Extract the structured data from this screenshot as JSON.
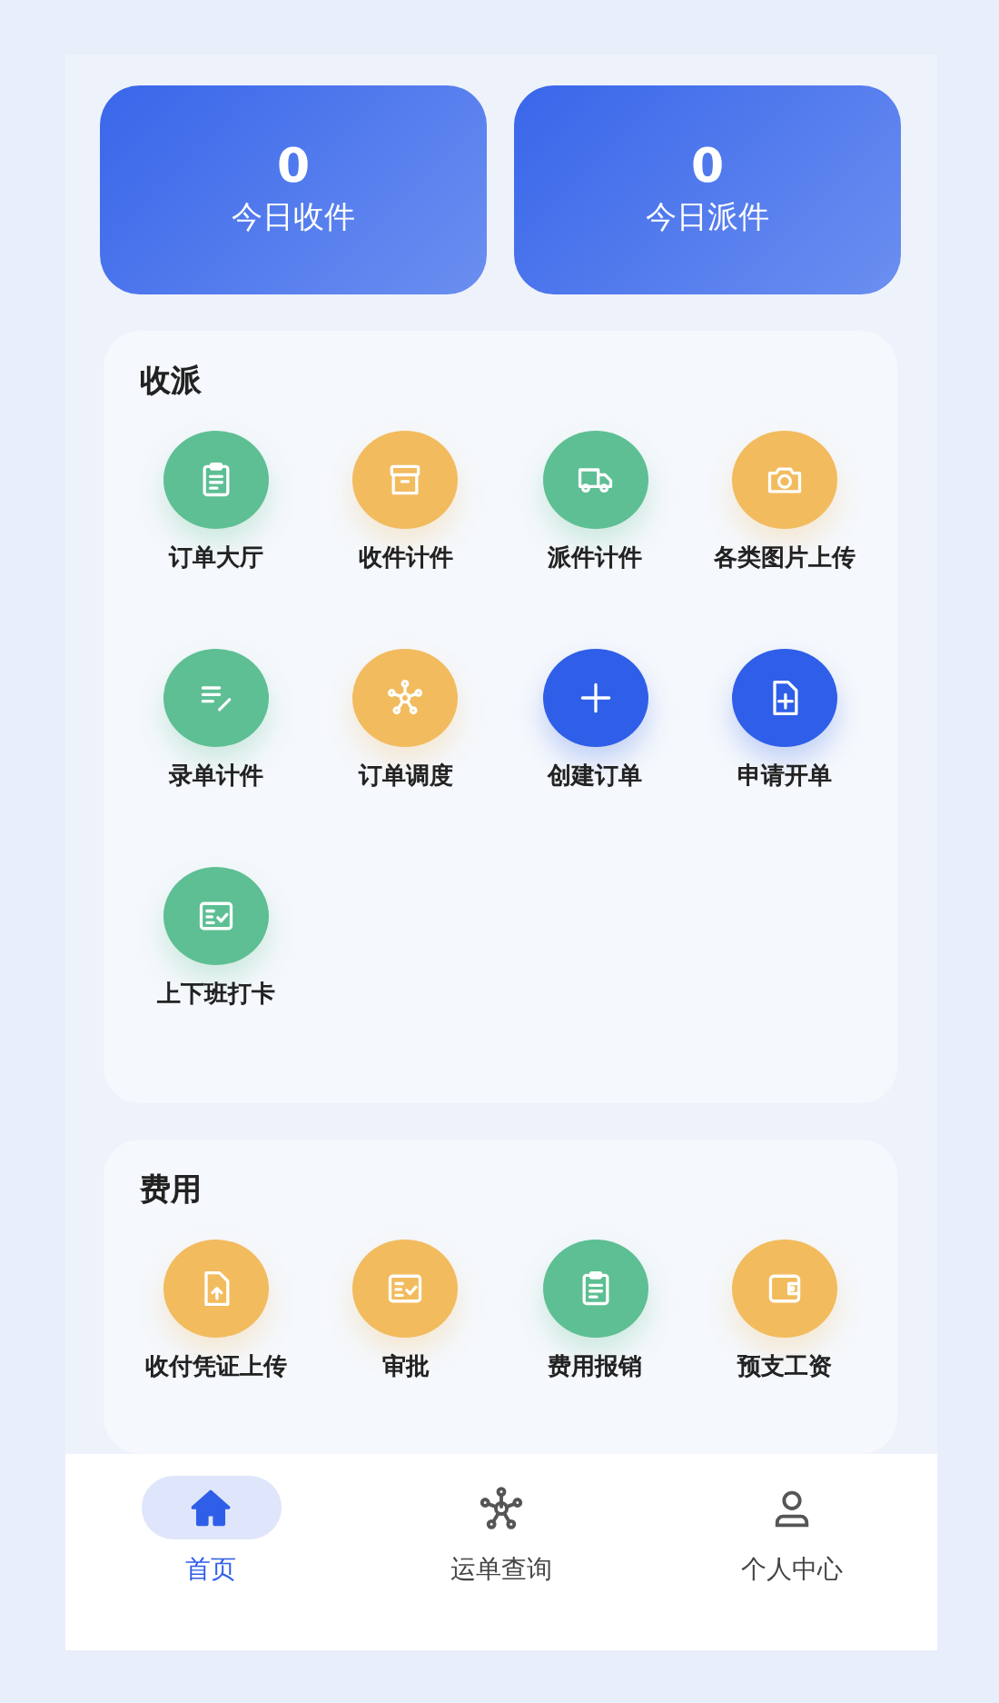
{
  "stats": [
    {
      "value": "0",
      "label": "今日收件"
    },
    {
      "value": "0",
      "label": "今日派件"
    }
  ],
  "sections": [
    {
      "title": "收派",
      "items": [
        {
          "label": "订单大厅",
          "color": "#5dbf93"
        },
        {
          "label": "收件计件",
          "color": "#f2bb5e"
        },
        {
          "label": "派件计件",
          "color": "#5dbf93"
        },
        {
          "label": "各类图片上传",
          "color": "#f2bb5e"
        },
        {
          "label": "录单计件",
          "color": "#5dbf93"
        },
        {
          "label": "订单调度",
          "color": "#f2bb5e"
        },
        {
          "label": "创建订单",
          "color": "#2f5ee8"
        },
        {
          "label": "申请开单",
          "color": "#2f5ee8"
        },
        {
          "label": "上下班打卡",
          "color": "#5dbf93"
        }
      ]
    },
    {
      "title": "费用",
      "items": [
        {
          "label": "收付凭证上传",
          "color": "#f2bb5e"
        },
        {
          "label": "审批",
          "color": "#f2bb5e"
        },
        {
          "label": "费用报销",
          "color": "#5dbf93"
        },
        {
          "label": "预支工资",
          "color": "#f2bb5e"
        }
      ]
    }
  ],
  "nav": [
    {
      "label": "首页",
      "selected": true
    },
    {
      "label": "运单查询",
      "selected": false
    },
    {
      "label": "个人中心",
      "selected": false
    }
  ]
}
